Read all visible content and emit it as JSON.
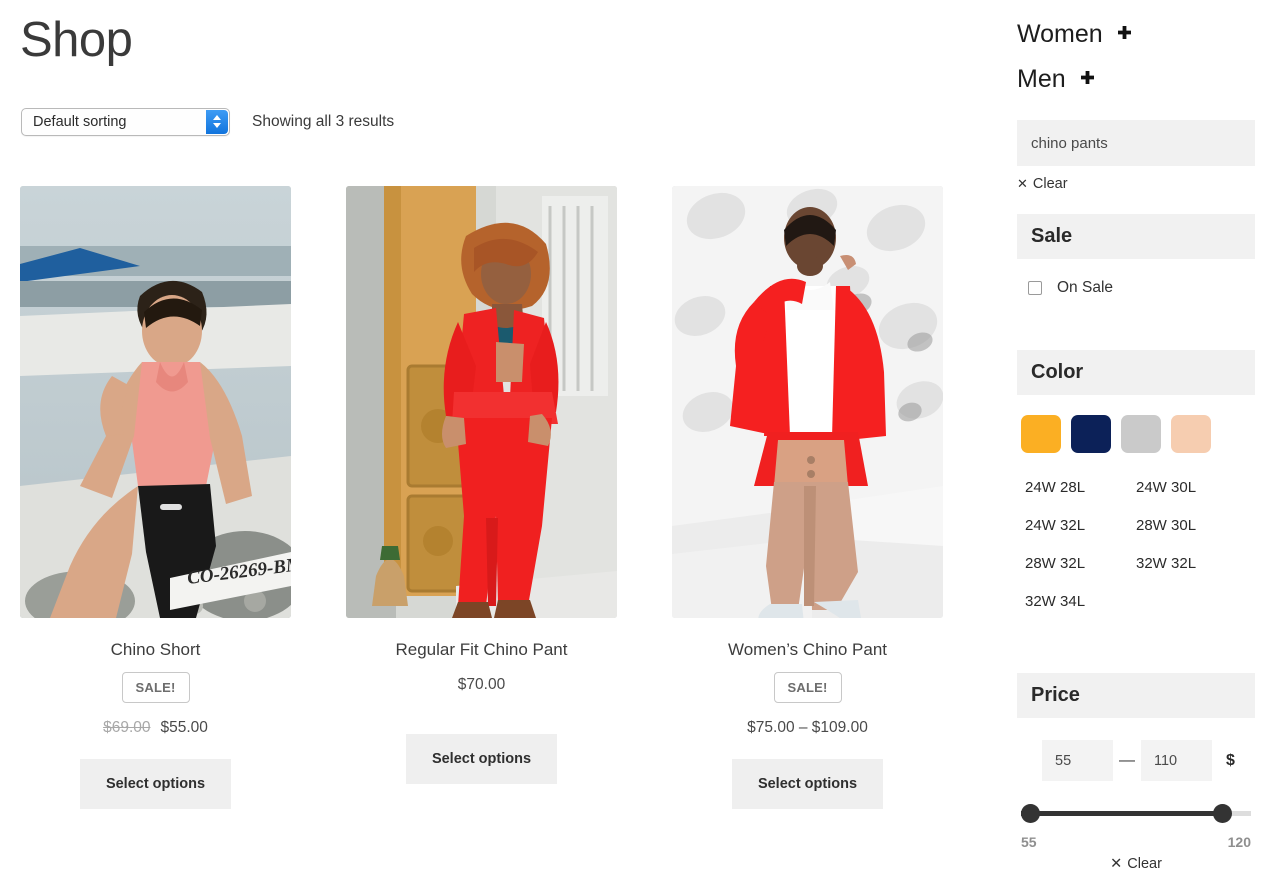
{
  "header": {
    "title": "Shop",
    "sorting": {
      "selected": "Default sorting",
      "icon": "chevron-updown-icon"
    },
    "results_text": "Showing all 3 results"
  },
  "products": [
    {
      "title": "Chino Short",
      "on_sale": true,
      "sale_label": "SALE!",
      "price_old": "$69.00",
      "price_new": "$55.00",
      "price_display": "",
      "button_label": "Select options",
      "image_alt": "man in pink tank top and black shorts sitting on a white boat"
    },
    {
      "title": "Regular Fit Chino Pant",
      "on_sale": false,
      "sale_label": "",
      "price_old": "",
      "price_new": "",
      "price_display": "$70.00",
      "button_label": "Select options",
      "image_alt": "woman in red suit standing by a wooden door"
    },
    {
      "title": "Women’s Chino Pant",
      "on_sale": true,
      "sale_label": "SALE!",
      "price_old": "",
      "price_new": "",
      "price_display": "$75.00 – $109.00",
      "button_label": "Select options",
      "image_alt": "woman in red cardigan and beige chino pants in white studio"
    }
  ],
  "sidebar": {
    "categories": [
      {
        "label": "Women",
        "expand_icon": "plus-icon"
      },
      {
        "label": "Men",
        "expand_icon": "plus-icon"
      }
    ],
    "search": {
      "value": "chino pants",
      "clear_label": "Clear",
      "clear_icon": "close-x-icon"
    },
    "sale": {
      "heading": "Sale",
      "option_label": "On Sale",
      "checked": false
    },
    "color": {
      "heading": "Color",
      "swatches": [
        {
          "name": "amber",
          "hex": "#FBAF23"
        },
        {
          "name": "navy",
          "hex": "#0C2158"
        },
        {
          "name": "light-gray",
          "hex": "#CACACA"
        },
        {
          "name": "peach",
          "hex": "#F6CDB0"
        }
      ]
    },
    "sizes": [
      "24W 28L",
      "24W 30L",
      "24W 32L",
      "28W 30L",
      "28W 32L",
      "32W 32L",
      "32W 34L"
    ],
    "price": {
      "heading": "Price",
      "min_value": "55",
      "max_value": "110",
      "separator": "—",
      "currency": "$",
      "range_min_label": "55",
      "range_max_label": "120",
      "clear_label": "Clear",
      "clear_icon": "close-x-icon"
    }
  }
}
